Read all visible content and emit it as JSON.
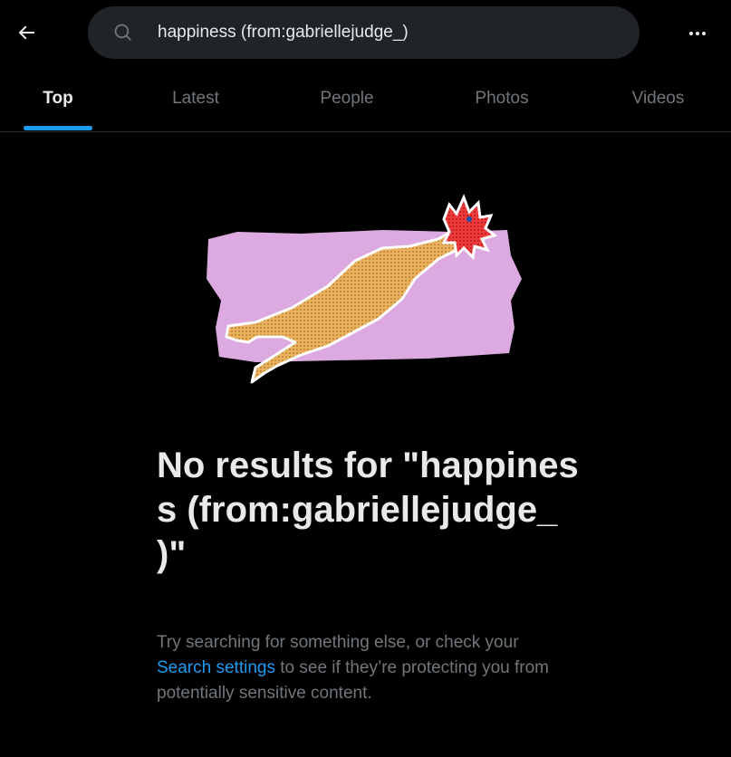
{
  "header": {
    "search_value": "happiness (from:gabriellejudge_)",
    "back_icon": "arrow-left-icon",
    "search_icon": "search-icon",
    "more_icon": "more-horizontal-icon"
  },
  "tabs": [
    {
      "label": "Top",
      "active": true
    },
    {
      "label": "Latest",
      "active": false
    },
    {
      "label": "People",
      "active": false
    },
    {
      "label": "Photos",
      "active": false
    },
    {
      "label": "Videos",
      "active": false
    }
  ],
  "empty_state": {
    "title": "No results for \"happiness (from:gabriellejudge_ )\"",
    "desc_before": "Try searching for something else, or check your ",
    "desc_link": "Search settings",
    "desc_after": " to see if they’re protecting you from potentially sensitive content.",
    "illustration": "rubber-chicken-illustration"
  },
  "colors": {
    "background": "#000000",
    "accent": "#1d9bf0",
    "text_primary": "#e7e9ea",
    "text_secondary": "#71767b",
    "search_bg": "#202327",
    "illustration_bg": "#dcaae0"
  }
}
